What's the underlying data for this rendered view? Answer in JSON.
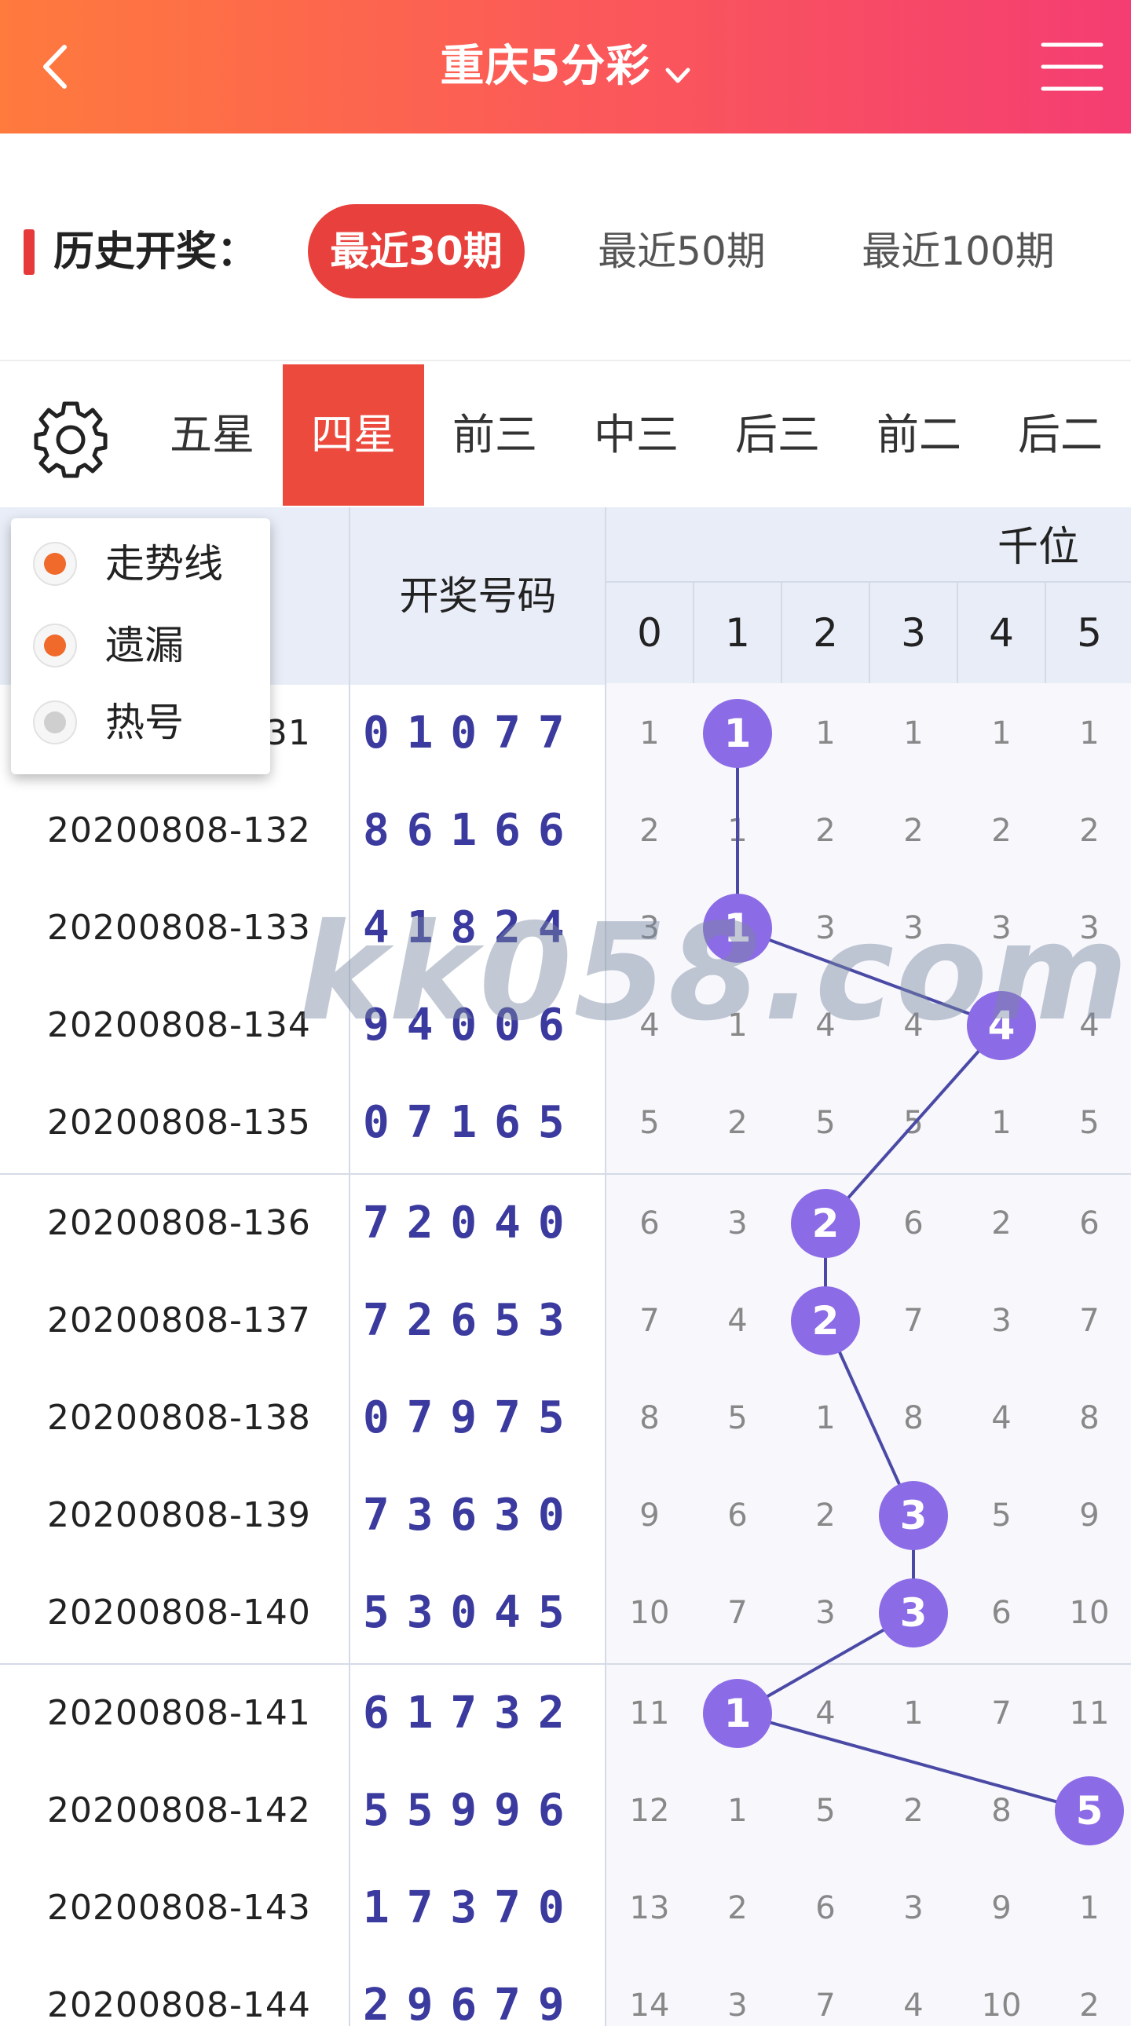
{
  "header": {
    "title": "重庆5分彩",
    "back_icon": "chevron-left-icon",
    "menu_icon": "hamburger-menu-icon",
    "title_dropdown_icon": "chevron-down-icon",
    "gradient_from": "#ff7a3d",
    "gradient_to": "#f43d72"
  },
  "history": {
    "label": "历史开奖：",
    "ranges": [
      {
        "label": "最近30期",
        "active": true
      },
      {
        "label": "最近50期",
        "active": false
      },
      {
        "label": "最近100期",
        "active": false
      }
    ],
    "accent": "#e8403c"
  },
  "tabs": {
    "settings_icon": "gear-icon",
    "items": [
      {
        "label": "五星",
        "active": false
      },
      {
        "label": "四星",
        "active": true
      },
      {
        "label": "前三",
        "active": false
      },
      {
        "label": "中三",
        "active": false
      },
      {
        "label": "后三",
        "active": false
      },
      {
        "label": "前二",
        "active": false
      },
      {
        "label": "后二",
        "active": false
      }
    ]
  },
  "table": {
    "draw_header": "开奖号码",
    "position_label": "千位",
    "digit_headers": [
      "0",
      "1",
      "2",
      "3",
      "4",
      "5"
    ],
    "rows": [
      {
        "period": "20200808-131",
        "draw": "01077",
        "cells": [
          "1",
          "1",
          "1",
          "1",
          "1",
          "1"
        ],
        "hit": 1
      },
      {
        "period": "20200808-132",
        "draw": "86166",
        "cells": [
          "2",
          "1",
          "2",
          "2",
          "2",
          "2"
        ],
        "hit": null
      },
      {
        "period": "20200808-133",
        "draw": "41824",
        "cells": [
          "3",
          "1",
          "3",
          "3",
          "3",
          "3"
        ],
        "hit": 1
      },
      {
        "period": "20200808-134",
        "draw": "94006",
        "cells": [
          "4",
          "1",
          "4",
          "4",
          "4",
          "4"
        ],
        "hit": 4
      },
      {
        "period": "20200808-135",
        "draw": "07165",
        "cells": [
          "5",
          "2",
          "5",
          "5",
          "1",
          "5"
        ],
        "hit": null
      },
      {
        "period": "20200808-136",
        "draw": "72040",
        "cells": [
          "6",
          "3",
          "2",
          "6",
          "2",
          "6"
        ],
        "hit": 2
      },
      {
        "period": "20200808-137",
        "draw": "72653",
        "cells": [
          "7",
          "4",
          "2",
          "7",
          "3",
          "7"
        ],
        "hit": 2
      },
      {
        "period": "20200808-138",
        "draw": "07975",
        "cells": [
          "8",
          "5",
          "1",
          "8",
          "4",
          "8"
        ],
        "hit": null
      },
      {
        "period": "20200808-139",
        "draw": "73630",
        "cells": [
          "9",
          "6",
          "2",
          "3",
          "5",
          "9"
        ],
        "hit": 3
      },
      {
        "period": "20200808-140",
        "draw": "53045",
        "cells": [
          "10",
          "7",
          "3",
          "3",
          "6",
          "10"
        ],
        "hit": 3
      },
      {
        "period": "20200808-141",
        "draw": "61732",
        "cells": [
          "11",
          "1",
          "4",
          "1",
          "7",
          "11"
        ],
        "hit": 1
      },
      {
        "period": "20200808-142",
        "draw": "55996",
        "cells": [
          "12",
          "1",
          "5",
          "2",
          "8",
          "5"
        ],
        "hit": 5
      },
      {
        "period": "20200808-143",
        "draw": "17370",
        "cells": [
          "13",
          "2",
          "6",
          "3",
          "9",
          "1"
        ],
        "hit": null
      },
      {
        "period": "20200808-144",
        "draw": "29679",
        "cells": [
          "14",
          "3",
          "7",
          "4",
          "10",
          "2"
        ],
        "hit": null
      }
    ],
    "ball_color": "#8c6be6",
    "line_color": "#4a4aa6"
  },
  "watermark": "kk058.com",
  "popup": {
    "options": [
      {
        "label": "走势线",
        "checked": true
      },
      {
        "label": "遗漏",
        "checked": true
      },
      {
        "label": "热号",
        "checked": false
      }
    ]
  }
}
